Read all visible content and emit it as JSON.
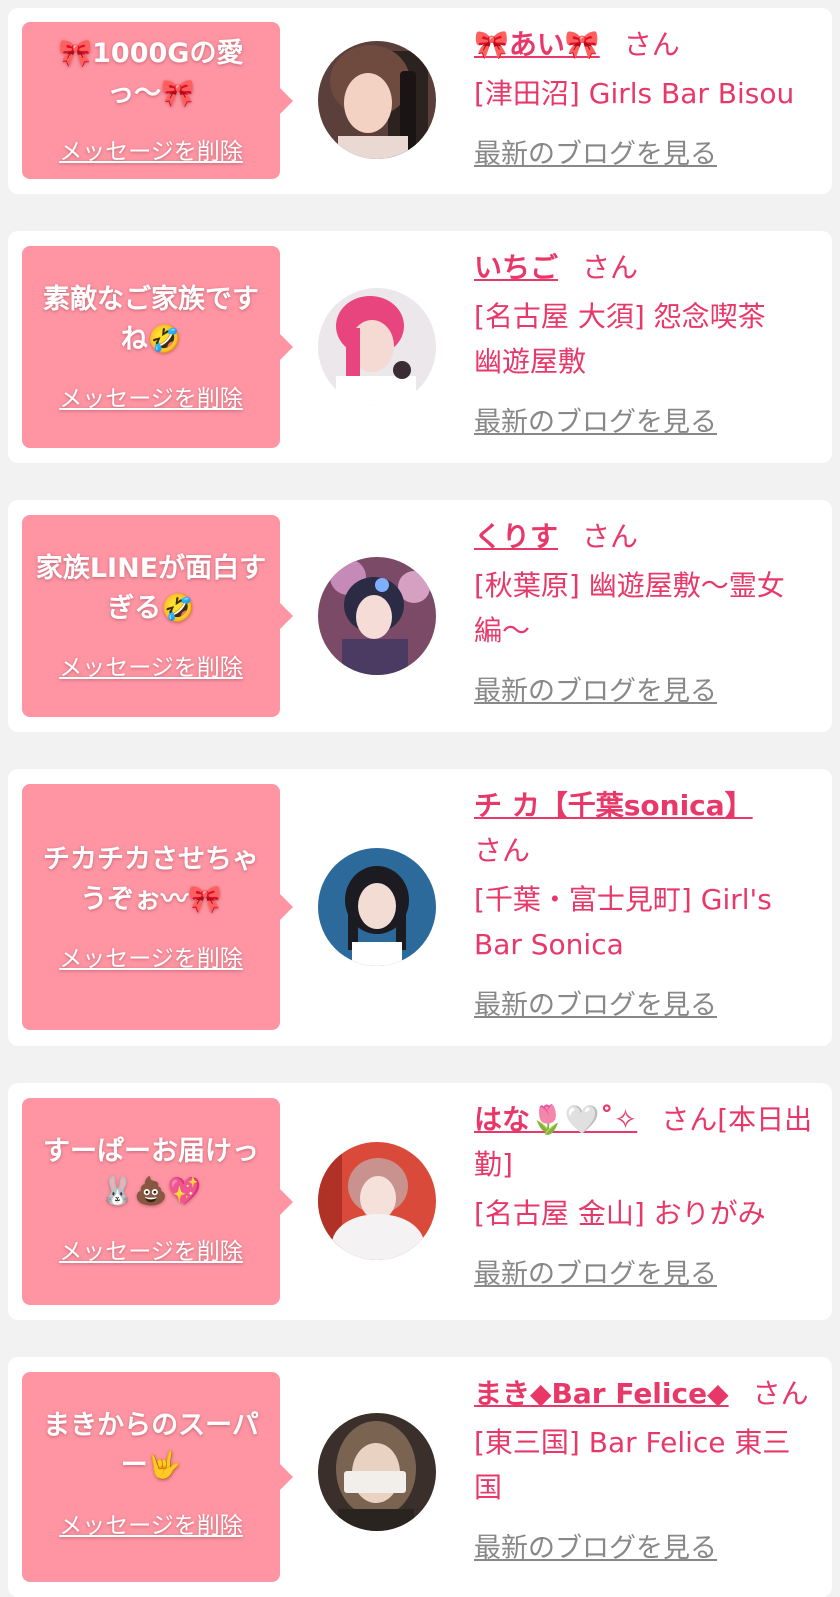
{
  "entries": [
    {
      "message": "🎀1000Gの愛\nっ〜🎀",
      "delete_label": "メッセージを削除",
      "name": "🎀あい🎀",
      "honorific": "さん",
      "store": "[津田沼] Girls Bar Bisou",
      "blog_link": "最新のブログを見る"
    },
    {
      "message": "素敵なご家族です\nね🤣",
      "delete_label": "メッセージを削除",
      "name": "いちご",
      "honorific": "さん",
      "store": "[名古屋 大須] 怨念喫茶\n幽遊屋敷",
      "blog_link": "最新のブログを見る"
    },
    {
      "message": "家族LINEが面白す\nぎる🤣",
      "delete_label": "メッセージを削除",
      "name": "くりす",
      "honorific": "さん",
      "store": "[秋葉原] 幽遊屋敷〜霊女\n編〜",
      "blog_link": "最新のブログを見る"
    },
    {
      "message": "チカチカさせちゃ\nうぞぉ〰🎀",
      "delete_label": "メッセージを削除",
      "name": "チ カ【千葉sonica】",
      "honorific": "さん",
      "store": "[千葉・富士見町] Girl's\nBar Sonica",
      "blog_link": "最新のブログを見る"
    },
    {
      "message": "すーぱーお届けっ\n🐰💩💖",
      "delete_label": "メッセージを削除",
      "name": "はな🌷🤍˚✧",
      "honorific": "さん[本日出勤]",
      "store": "[名古屋 金山] おりがみ",
      "blog_link": "最新のブログを見る"
    },
    {
      "message": "まきからのスーパ\nー🤟",
      "delete_label": "メッセージを削除",
      "name": "まき◆Bar Felice◆",
      "honorific": "さん",
      "store": "[東三国] Bar Felice 東三\n国",
      "blog_link": "最新のブログを見る"
    }
  ],
  "colors": {
    "accent": "#e8386a",
    "bubble": "#ff95a3",
    "background": "#f2f2f2",
    "link_gray": "#888888"
  }
}
